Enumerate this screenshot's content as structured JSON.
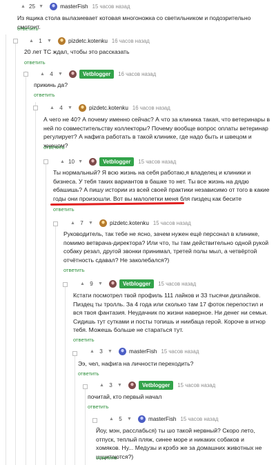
{
  "reply_label": "ответить",
  "colors": {
    "reply": "#2e8f3c",
    "author_badge": "#32a34a",
    "annotation": "#e11e1e"
  },
  "comments": [
    {
      "score": "25",
      "author": "masterFish",
      "time": "15 часов назад",
      "text": "Из ящика стола вылазиевает котовая многоножка со светильником и подозрительно смотрит."
    },
    {
      "score": "1",
      "author": "pizdetc.kotenku",
      "time": "16 часов назад",
      "text": "20 лет ТС ждал, чтобы это рассказать"
    },
    {
      "score": "4",
      "author": "Vetblogger",
      "time": "16 часов назад",
      "text": "прикинь да?"
    },
    {
      "score": "4",
      "author": "pizdetc.kotenku",
      "time": "16 часов назад",
      "text": "А чего не 40? А почему именно сейчас? А что за клиника такая, что ветеринары в ней по совместительству коллекторы? Почему вообще вопрос оплаты ветеринар регулирует? А нафига работать в такой клинике, где надо быть и швецом и жнецом?"
    },
    {
      "score": "10",
      "author": "Vetblogger",
      "time": "15 часов назад",
      "text": "Ты нормальный? Я всю жизнь на себя работаю,я владелец и клиники и бизнеса. У тебя таких вариантов в башке то нет. Ты все жизнь на дядю ебашишь? А пишу истории из всей своей практики независимо от того в какие годы они произошли. Вот вы малолетки меня бля пиздец как бесите"
    },
    {
      "score": "7",
      "author": "pizdetc.kotenku",
      "time": "15 часов назад",
      "text": "Руководитель, так тебе не ясно, зачем нужен ещё персонал в клинике, помимо ветврача-директора? Или что, ты там действительно одной рукой собаку резал, другой звонки принимал, третей полы мыл, а четвёртой отчётность сдавал? Не заколебался?)"
    },
    {
      "score": "9",
      "author": "Vetblogger",
      "time": "15 часов назад",
      "text": "Кстати посмотрел твой профиль 111 лайков и 33 тысячи дизлайков. Пиздец ты тролль. За 4 года или сколько там 17 фоток перепостил и вся твоя фантазия. Неудачник по жизни наверное. Ни денег ни семьи. Сидишь тут сутками и посты топишь и ниибаца герой. Короче в игнор тебя. Можешь больше не стараться тут."
    },
    {
      "score": "3",
      "author": "masterFish",
      "time": "15 часов назад",
      "text": "Ээ, чел, нафига на личности переходить?"
    },
    {
      "score": "3",
      "author": "Vetblogger",
      "time": "15 часов назад",
      "text": "почитай, кто первый начал"
    },
    {
      "score": "5",
      "author": "masterFish",
      "time": "15 часов назад",
      "text": "Йоу, мэн, расслабься) ты шо такой нервный? Скоро лето, отпуск, теплый пляж, синее море и никаких собаков и хомяков. Ну... Медузы и крэбэ же за домашних животных не щщитаются?)"
    }
  ]
}
